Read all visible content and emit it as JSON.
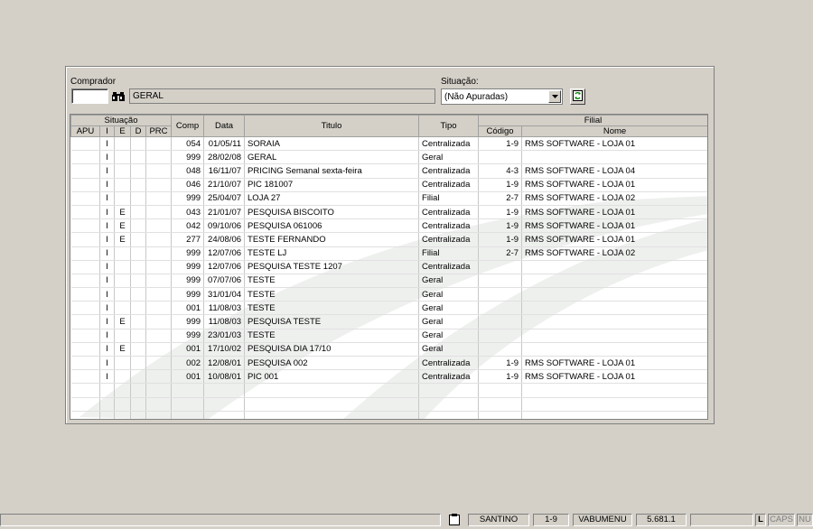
{
  "filters": {
    "comprador_label": "Comprador",
    "comprador_code": "",
    "comprador_name": "GERAL",
    "situacao_label": "Situação:",
    "situacao_value": "(Não Apuradas)"
  },
  "grid": {
    "group_headers": {
      "situacao": "Situação",
      "filial": "Filial"
    },
    "headers": {
      "apu": "APU",
      "i": "I",
      "e": "E",
      "d": "D",
      "prc": "PRC",
      "comp": "Comp",
      "data": "Data",
      "titulo": "Titulo",
      "tipo": "Tipo",
      "codigo": "Código",
      "nome": "Nome"
    },
    "rows": [
      {
        "apu": "",
        "i": "I",
        "e": "",
        "d": "",
        "prc": "",
        "comp": "054",
        "data": "01/05/11",
        "titulo": "SORAIA",
        "tipo": "Centralizada",
        "codigo": "1-9",
        "nome": "RMS SOFTWARE - LOJA 01"
      },
      {
        "apu": "",
        "i": "I",
        "e": "",
        "d": "",
        "prc": "",
        "comp": "999",
        "data": "28/02/08",
        "titulo": "GERAL",
        "tipo": "Geral",
        "codigo": "",
        "nome": ""
      },
      {
        "apu": "",
        "i": "I",
        "e": "",
        "d": "",
        "prc": "",
        "comp": "048",
        "data": "16/11/07",
        "titulo": "PRICING Semanal sexta-feira",
        "tipo": "Centralizada",
        "codigo": "4-3",
        "nome": "RMS SOFTWARE - LOJA 04"
      },
      {
        "apu": "",
        "i": "I",
        "e": "",
        "d": "",
        "prc": "",
        "comp": "046",
        "data": "21/10/07",
        "titulo": "PIC 181007",
        "tipo": "Centralizada",
        "codigo": "1-9",
        "nome": "RMS SOFTWARE - LOJA 01"
      },
      {
        "apu": "",
        "i": "I",
        "e": "",
        "d": "",
        "prc": "",
        "comp": "999",
        "data": "25/04/07",
        "titulo": "LOJA 27",
        "tipo": "Filial",
        "codigo": "2-7",
        "nome": "RMS SOFTWARE - LOJA 02"
      },
      {
        "apu": "",
        "i": "I",
        "e": "E",
        "d": "",
        "prc": "",
        "comp": "043",
        "data": "21/01/07",
        "titulo": "PESQUISA BISCOITO",
        "tipo": "Centralizada",
        "codigo": "1-9",
        "nome": "RMS SOFTWARE - LOJA 01"
      },
      {
        "apu": "",
        "i": "I",
        "e": "E",
        "d": "",
        "prc": "",
        "comp": "042",
        "data": "09/10/06",
        "titulo": "PESQUISA 061006",
        "tipo": "Centralizada",
        "codigo": "1-9",
        "nome": "RMS SOFTWARE - LOJA 01"
      },
      {
        "apu": "",
        "i": "I",
        "e": "E",
        "d": "",
        "prc": "",
        "comp": "277",
        "data": "24/08/06",
        "titulo": "TESTE FERNANDO",
        "tipo": "Centralizada",
        "codigo": "1-9",
        "nome": "RMS SOFTWARE - LOJA 01"
      },
      {
        "apu": "",
        "i": "I",
        "e": "",
        "d": "",
        "prc": "",
        "comp": "999",
        "data": "12/07/06",
        "titulo": "TESTE LJ",
        "tipo": "Filial",
        "codigo": "2-7",
        "nome": "RMS SOFTWARE - LOJA 02"
      },
      {
        "apu": "",
        "i": "I",
        "e": "",
        "d": "",
        "prc": "",
        "comp": "999",
        "data": "12/07/06",
        "titulo": "PESQUISA TESTE 1207",
        "tipo": "Centralizada",
        "codigo": "",
        "nome": ""
      },
      {
        "apu": "",
        "i": "I",
        "e": "",
        "d": "",
        "prc": "",
        "comp": "999",
        "data": "07/07/06",
        "titulo": "TESTE",
        "tipo": "Geral",
        "codigo": "",
        "nome": ""
      },
      {
        "apu": "",
        "i": "I",
        "e": "",
        "d": "",
        "prc": "",
        "comp": "999",
        "data": "31/01/04",
        "titulo": "TESTE",
        "tipo": "Geral",
        "codigo": "",
        "nome": ""
      },
      {
        "apu": "",
        "i": "I",
        "e": "",
        "d": "",
        "prc": "",
        "comp": "001",
        "data": "11/08/03",
        "titulo": "TESTE",
        "tipo": "Geral",
        "codigo": "",
        "nome": ""
      },
      {
        "apu": "",
        "i": "I",
        "e": "E",
        "d": "",
        "prc": "",
        "comp": "999",
        "data": "11/08/03",
        "titulo": "PESQUISA TESTE",
        "tipo": "Geral",
        "codigo": "",
        "nome": ""
      },
      {
        "apu": "",
        "i": "I",
        "e": "",
        "d": "",
        "prc": "",
        "comp": "999",
        "data": "23/01/03",
        "titulo": "TESTE",
        "tipo": "Geral",
        "codigo": "",
        "nome": ""
      },
      {
        "apu": "",
        "i": "I",
        "e": "E",
        "d": "",
        "prc": "",
        "comp": "001",
        "data": "17/10/02",
        "titulo": "PESQUISA DIA 17/10",
        "tipo": "Geral",
        "codigo": "",
        "nome": ""
      },
      {
        "apu": "",
        "i": "I",
        "e": "",
        "d": "",
        "prc": "",
        "comp": "002",
        "data": "12/08/01",
        "titulo": "PESQUISA 002",
        "tipo": "Centralizada",
        "codigo": "1-9",
        "nome": "RMS SOFTWARE - LOJA 01"
      },
      {
        "apu": "",
        "i": "I",
        "e": "",
        "d": "",
        "prc": "",
        "comp": "001",
        "data": "10/08/01",
        "titulo": "PIC 001",
        "tipo": "Centralizada",
        "codigo": "1-9",
        "nome": "RMS SOFTWARE - LOJA 01"
      }
    ]
  },
  "statusbar": {
    "user": "SANTINO",
    "filial": "1-9",
    "program": "VABUMENU",
    "version": "5.681.1",
    "l": "L",
    "caps": "CAPS",
    "num": "NU"
  },
  "icons": {
    "search": "binoculars-icon",
    "dropdown": "chevron-down-icon",
    "refresh": "refresh-icon",
    "clipboard": "clipboard-icon"
  }
}
